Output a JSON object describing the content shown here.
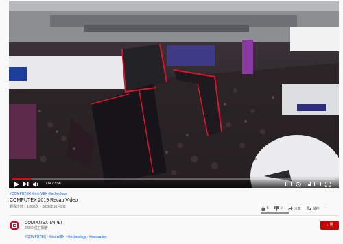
{
  "video": {
    "progress_fraction": 0.06,
    "time_display": "0:14 / 3:56"
  },
  "info": {
    "hashtags": "#COMPUTEX #InnoVEX #technology",
    "title": "COMPUTEX 2019 Recap Video",
    "meta": "觀看次數：1,935次・2020年10月8日",
    "like_count": "5",
    "dislike_count": "0",
    "share_label": "分享",
    "save_label": "儲存",
    "like_ratio": 1.0
  },
  "channel": {
    "name": "COMPUTEX TAIPEI",
    "subscribers": "2,560 位訂閱者",
    "subscribe_label": "訂閱",
    "brand_color": "#c8102e"
  },
  "description": {
    "hashtags": "#COMPUTEX · #InnoVEX · #technology · #innovation"
  },
  "icons": {
    "play": "play-icon",
    "next": "next-icon",
    "volume": "volume-icon",
    "captions": "captions-icon",
    "settings": "settings-icon",
    "miniplayer": "miniplayer-icon",
    "theater": "theater-icon",
    "fullscreen": "fullscreen-icon",
    "like": "thumbs-up-icon",
    "dislike": "thumbs-down-icon",
    "share": "share-icon",
    "save": "save-icon",
    "more": "more-icon"
  },
  "colors": {
    "progress": "#ee0000",
    "subscribe": "#cc0000",
    "link": "#065fd4"
  }
}
